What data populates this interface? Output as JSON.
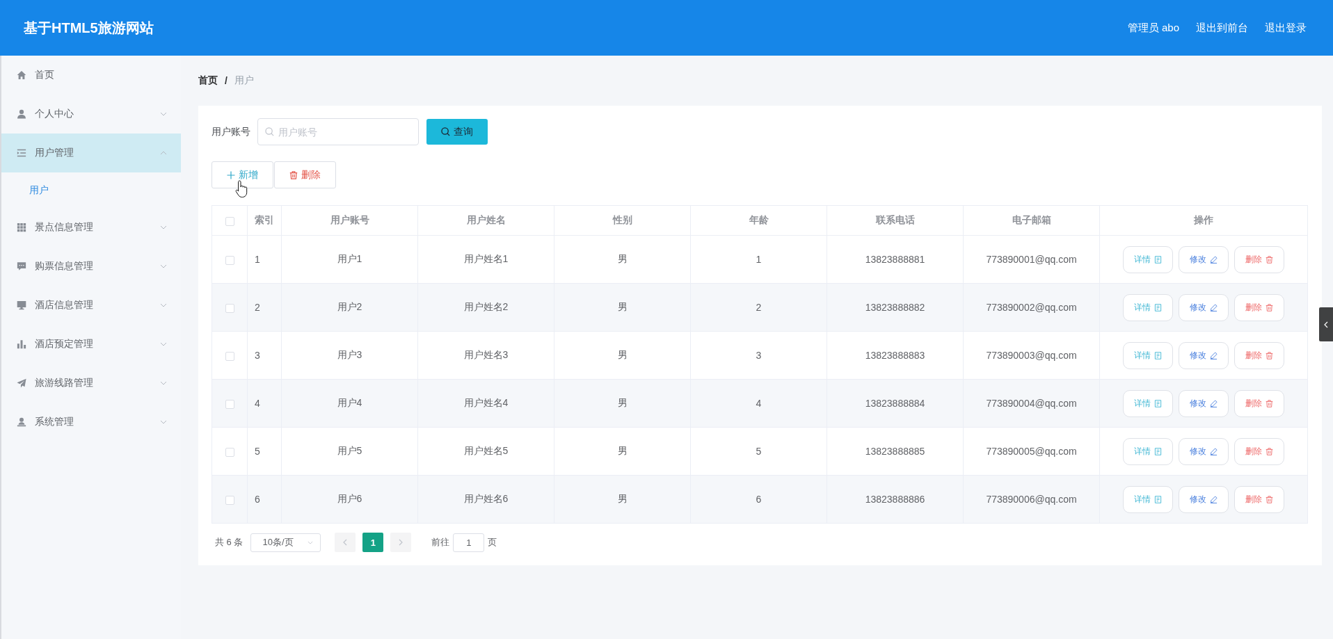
{
  "header": {
    "title": "基于HTML5旅游网站",
    "user": "管理员 abo",
    "links": [
      "退出到前台",
      "退出登录"
    ]
  },
  "sidebar": {
    "items": [
      {
        "kind": "link",
        "label": "首页",
        "selected": false
      },
      {
        "kind": "submenu",
        "label": "个人中心",
        "selected": false,
        "expanded": false
      },
      {
        "kind": "submenu",
        "label": "用户管理",
        "selected": true,
        "expanded": true,
        "children": [
          {
            "label": "用户",
            "selected": true
          }
        ]
      },
      {
        "kind": "submenu",
        "label": "景点信息管理",
        "selected": false,
        "expanded": false
      },
      {
        "kind": "submenu",
        "label": "购票信息管理",
        "selected": false,
        "expanded": false
      },
      {
        "kind": "submenu",
        "label": "酒店信息管理",
        "selected": false,
        "expanded": false
      },
      {
        "kind": "submenu",
        "label": "酒店预定管理",
        "selected": false,
        "expanded": false
      },
      {
        "kind": "submenu",
        "label": "旅游线路管理",
        "selected": false,
        "expanded": false
      },
      {
        "kind": "submenu",
        "label": "系统管理",
        "selected": false,
        "expanded": false
      }
    ]
  },
  "breadcrumb": {
    "separator": "/",
    "items": [
      {
        "label": "首页",
        "current": false
      },
      {
        "label": "用户",
        "current": true
      }
    ]
  },
  "search": {
    "label": "用户账号",
    "placeholder": "用户账号",
    "button": "查询"
  },
  "toolbar": [
    {
      "kind": "add",
      "label": "新增"
    },
    {
      "kind": "delete",
      "label": "删除"
    }
  ],
  "table": {
    "all_checked": false,
    "columns": [
      "索引",
      "用户账号",
      "用户姓名",
      "性别",
      "年龄",
      "联系电话",
      "电子邮箱",
      "操作"
    ],
    "rows": [
      {
        "checked": false,
        "cells": [
          "1",
          "用户1",
          "用户姓名1",
          "男",
          "1",
          "13823888881",
          "773890001@qq.com"
        ],
        "actions": [
          {
            "kind": "detail",
            "label": "详情"
          },
          {
            "kind": "edit",
            "label": "修改"
          },
          {
            "kind": "delete",
            "label": "删除"
          }
        ]
      },
      {
        "checked": false,
        "cells": [
          "2",
          "用户2",
          "用户姓名2",
          "男",
          "2",
          "13823888882",
          "773890002@qq.com"
        ],
        "actions": [
          {
            "kind": "detail",
            "label": "详情"
          },
          {
            "kind": "edit",
            "label": "修改"
          },
          {
            "kind": "delete",
            "label": "删除"
          }
        ]
      },
      {
        "checked": false,
        "cells": [
          "3",
          "用户3",
          "用户姓名3",
          "男",
          "3",
          "13823888883",
          "773890003@qq.com"
        ],
        "actions": [
          {
            "kind": "detail",
            "label": "详情"
          },
          {
            "kind": "edit",
            "label": "修改"
          },
          {
            "kind": "delete",
            "label": "删除"
          }
        ]
      },
      {
        "checked": false,
        "cells": [
          "4",
          "用户4",
          "用户姓名4",
          "男",
          "4",
          "13823888884",
          "773890004@qq.com"
        ],
        "actions": [
          {
            "kind": "detail",
            "label": "详情"
          },
          {
            "kind": "edit",
            "label": "修改"
          },
          {
            "kind": "delete",
            "label": "删除"
          }
        ]
      },
      {
        "checked": false,
        "cells": [
          "5",
          "用户5",
          "用户姓名5",
          "男",
          "5",
          "13823888885",
          "773890005@qq.com"
        ],
        "actions": [
          {
            "kind": "detail",
            "label": "详情"
          },
          {
            "kind": "edit",
            "label": "修改"
          },
          {
            "kind": "delete",
            "label": "删除"
          }
        ]
      },
      {
        "checked": false,
        "cells": [
          "6",
          "用户6",
          "用户姓名6",
          "男",
          "6",
          "13823888886",
          "773890006@qq.com"
        ],
        "actions": [
          {
            "kind": "detail",
            "label": "详情"
          },
          {
            "kind": "edit",
            "label": "修改"
          },
          {
            "kind": "delete",
            "label": "删除"
          }
        ]
      }
    ]
  },
  "pagination": {
    "total": "共 6 条",
    "page_size": "10条/页",
    "prev_disabled": true,
    "next_disabled": true,
    "pages": [
      {
        "label": "1",
        "selected": true
      }
    ],
    "goto_label": "前往",
    "goto_value": "1",
    "goto_suffix": "页"
  }
}
